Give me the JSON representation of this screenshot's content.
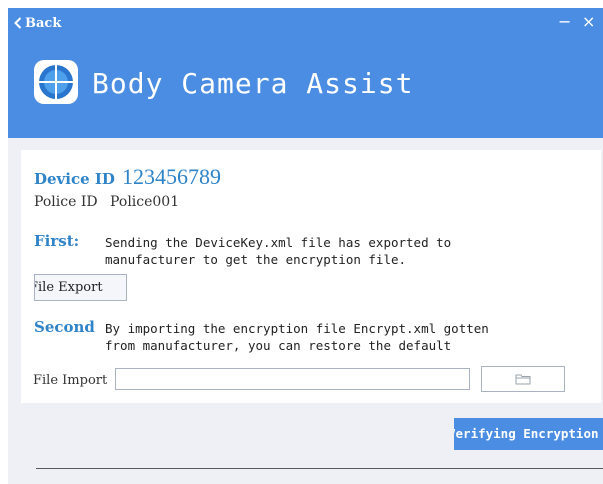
{
  "header": {
    "back_label": "Back",
    "minimize_symbol": "−",
    "close_symbol": "×",
    "app_title": "Body Camera Assist",
    "logo_icon": "crosshair-globe-icon"
  },
  "device": {
    "device_id_label": "Device ID",
    "device_id_value": "123456789",
    "police_id_label": "Police ID",
    "police_id_value": "Police001"
  },
  "steps": {
    "first": {
      "label": "First:",
      "text_line1": "Sending the DeviceKey.xml file has exported to",
      "text_line2": "manufacturer to get the encryption file."
    },
    "second": {
      "label": "Second",
      "text_line1": "By importing the encryption file Encrypt.xml gotten",
      "text_line2": "from manufacturer, you can restore the default"
    }
  },
  "actions": {
    "file_export_label": "File Export",
    "file_import_label": "File Import",
    "file_import_value": "",
    "browse_icon": "folder-icon",
    "verify_label": "Verifying Encryption"
  },
  "colors": {
    "header_bg": "#4a8de2",
    "accent_text": "#2f83c8",
    "window_bg": "#eef0f5"
  }
}
